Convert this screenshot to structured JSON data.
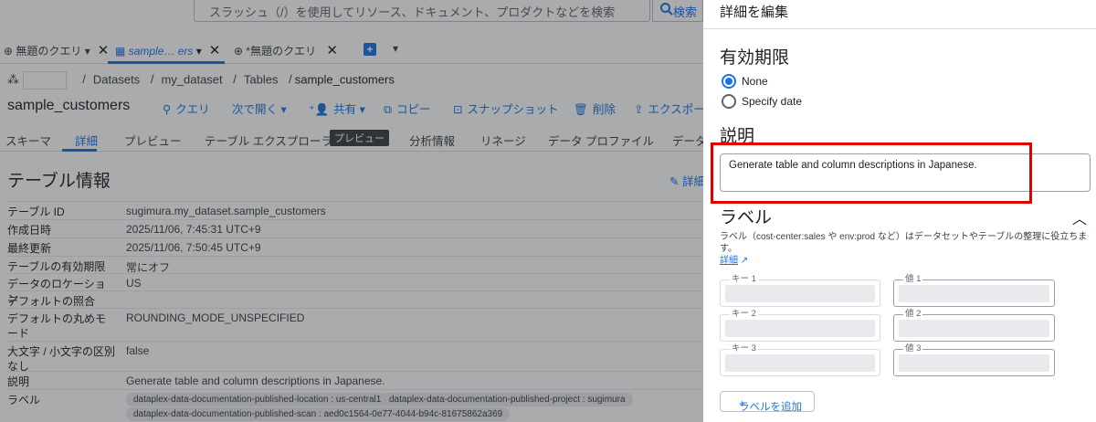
{
  "search": {
    "placeholder": "スラッシュ（/）を使用してリソース、ドキュメント、プロダクトなどを検索",
    "button": "検索"
  },
  "query_tabs": [
    {
      "label": "無題のクエリ"
    },
    {
      "label": "sample… ers"
    },
    {
      "label": "*無題のクエリ"
    }
  ],
  "breadcrumb": {
    "items": [
      "Datasets",
      "my_dataset",
      "Tables"
    ],
    "current": "sample_customers"
  },
  "page_title": "sample_customers",
  "toolbar": {
    "query": "クエリ",
    "open_in": "次で開く",
    "share": "共有",
    "copy": "コピー",
    "snapshot": "スナップショット",
    "delete": "削除",
    "export": "エクスポー"
  },
  "subtabs": {
    "schema": "スキーマ",
    "details": "詳細",
    "preview": "プレビュー",
    "explorer": "テーブル エクスプローラ",
    "explorer_badge": "プレビュー",
    "insights": "分析情報",
    "lineage": "リネージ",
    "profile": "データ プロファイル",
    "quality": "データ"
  },
  "table_info": {
    "title": "テーブル情報",
    "edit_label": "詳細",
    "rows": [
      {
        "key": "テーブル ID",
        "value": "sugimura.my_dataset.sample_customers"
      },
      {
        "key": "作成日時",
        "value": "2025/11/06, 7:45:31 UTC+9"
      },
      {
        "key": "最終更新",
        "value": "2025/11/06, 7:50:45 UTC+9"
      },
      {
        "key": "テーブルの有効期限",
        "value": "常にオフ"
      },
      {
        "key": "データのロケーション",
        "value": "US"
      },
      {
        "key": "デフォルトの照合",
        "value": ""
      },
      {
        "key": "デフォルトの丸めモード",
        "value": "ROUNDING_MODE_UNSPECIFIED"
      },
      {
        "key": "大文字 / 小文字の区別なし",
        "value": "false"
      },
      {
        "key": "説明",
        "value": "Generate table and column descriptions in Japanese."
      },
      {
        "key": "ラベル",
        "value": ""
      }
    ],
    "labels": [
      {
        "name": "dataplex-data-documentation-published-location",
        "value": "us-central1"
      },
      {
        "name": "dataplex-data-documentation-published-project",
        "value": "sugimura"
      },
      {
        "name": "dataplex-data-documentation-published-scan",
        "value": "aed0c1564-0e77-4044-b94c-81675862a369"
      }
    ]
  },
  "edit_panel": {
    "title": "詳細を編集",
    "expiration": {
      "heading": "有効期限",
      "options": [
        "None",
        "Specify date"
      ],
      "selected": "None"
    },
    "description": {
      "heading": "説明",
      "value": "Generate table and column descriptions in Japanese."
    },
    "labels": {
      "heading": "ラベル",
      "help": "ラベル（cost-center:sales や env:prod など）はデータセットやテーブルの整理に役立ちます。",
      "help_link": "詳細",
      "pairs": [
        {
          "key_label": "キー 1",
          "value_label": "値 1"
        },
        {
          "key_label": "キー 2",
          "value_label": "値 2"
        },
        {
          "key_label": "キー 3",
          "value_label": "値 3"
        }
      ],
      "add_button": "ラベルを追加"
    }
  },
  "colors": {
    "accent": "#1a73e8",
    "highlight": "#e00000"
  }
}
